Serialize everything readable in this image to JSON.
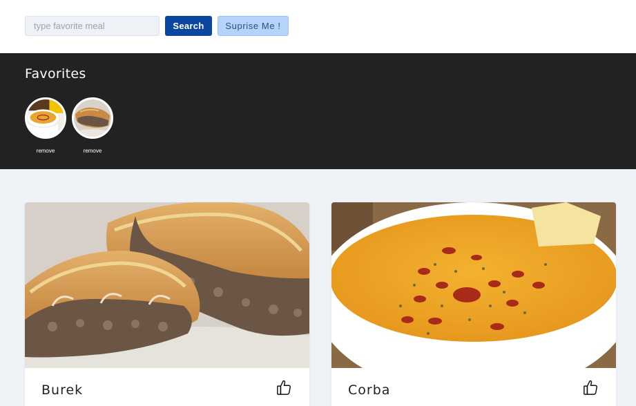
{
  "search": {
    "placeholder": "type favorite meal",
    "value": ""
  },
  "buttons": {
    "search_label": "Search",
    "surprise_label": "Suprise Me !"
  },
  "favorites": {
    "title": "Favorites",
    "items": [
      {
        "meal": "Corba",
        "remove_label": "remove"
      },
      {
        "meal": "Burek",
        "remove_label": "remove"
      }
    ]
  },
  "meals": [
    {
      "name": "Burek",
      "like_icon": "thumbs-up-icon"
    },
    {
      "name": "Corba",
      "like_icon": "thumbs-up-icon"
    }
  ],
  "colors": {
    "primary": "#0b47a0",
    "secondary": "#b6d3fa",
    "favorites_bg": "#222222",
    "page_bg": "#eff3f8"
  }
}
